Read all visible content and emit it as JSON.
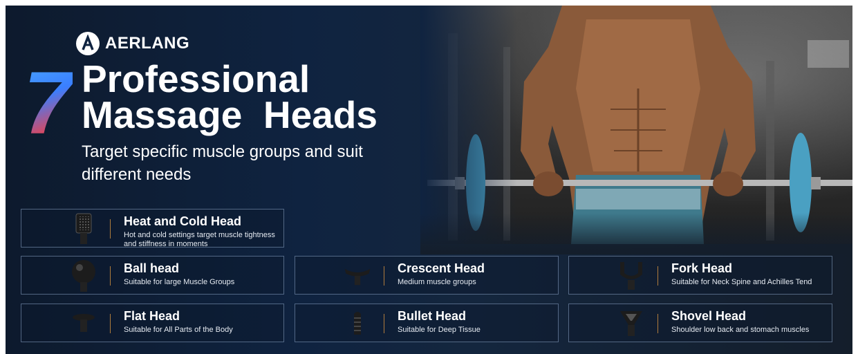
{
  "brand": {
    "name": "AERLANG",
    "logo_icon": "aerlang-logo-icon"
  },
  "headline": {
    "number": "7",
    "title_line1": "Professional",
    "title_line2": "Massage  Heads",
    "subtitle": "Target specific muscle groups and suit different needs"
  },
  "colors": {
    "background": "#0f2340",
    "accent_divider": "#b07c3c",
    "seven_top": "#3a7fff",
    "seven_bottom": "#ff3b3b"
  },
  "heads": [
    {
      "name": "Heat and Cold Head",
      "desc": "Hot and cold settings target muscle tightness and stiffness in moments",
      "icon": "heat-cold-head-icon"
    },
    {
      "name": "Ball head",
      "desc": "Suitable for large Muscle Groups",
      "icon": "ball-head-icon"
    },
    {
      "name": "Crescent Head",
      "desc": "Medium muscle groups",
      "icon": "crescent-head-icon"
    },
    {
      "name": "Fork Head",
      "desc": "Suitable for Neck Spine and Achilles Tend",
      "icon": "fork-head-icon"
    },
    {
      "name": "Flat Head",
      "desc": "Suitable for All Parts of the Body",
      "icon": "flat-head-icon"
    },
    {
      "name": "Bullet Head",
      "desc": "Suitable for Deep Tissue",
      "icon": "bullet-head-icon"
    },
    {
      "name": "Shovel Head",
      "desc": "Shoulder low back and stomach muscles",
      "icon": "shovel-head-icon"
    }
  ]
}
